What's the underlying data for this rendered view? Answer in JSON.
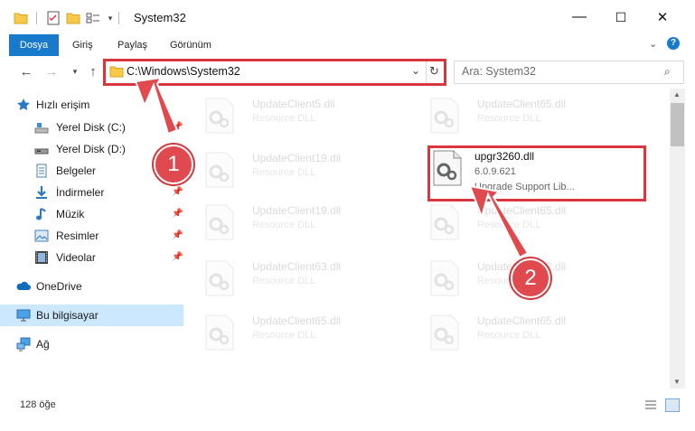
{
  "window": {
    "title": "System32",
    "buttons": {
      "minimize": "—",
      "maximize": "☐",
      "close": "✕"
    }
  },
  "ribbon": {
    "tabs": [
      {
        "label": "Dosya"
      },
      {
        "label": "Giriş"
      },
      {
        "label": "Paylaş"
      },
      {
        "label": "Görünüm"
      }
    ]
  },
  "address": {
    "path": "C:\\Windows\\System32"
  },
  "search": {
    "placeholder": "Ara: System32"
  },
  "sidebar": {
    "items": [
      {
        "label": "Hızlı erişim",
        "icon": "star-icon"
      },
      {
        "label": "Yerel Disk (C:)",
        "icon": "drive-icon"
      },
      {
        "label": "Yerel Disk (D:)",
        "icon": "drive-icon"
      },
      {
        "label": "Belgeler",
        "icon": "documents-icon"
      },
      {
        "label": "İndirmeler",
        "icon": "download-icon"
      },
      {
        "label": "Müzik",
        "icon": "music-icon"
      },
      {
        "label": "Resimler",
        "icon": "pictures-icon"
      },
      {
        "label": "Videolar",
        "icon": "videos-icon"
      },
      {
        "label": "OneDrive",
        "icon": "cloud-icon"
      },
      {
        "label": "Bu bilgisayar",
        "icon": "computer-icon"
      },
      {
        "label": "Ağ",
        "icon": "network-icon"
      }
    ]
  },
  "files": [
    {
      "name": "UpdateClient5.dll",
      "sub": "Resource DLL"
    },
    {
      "name": "UpdateClient65.dll",
      "sub": "Resource DLL"
    },
    {
      "name": "UpdateClient19.dll",
      "sub": "Resource DLL"
    },
    {
      "name": "upgr3260.dll",
      "version": "6.0.9.621",
      "desc": "Upgrade Support Lib..."
    },
    {
      "name": "UpdateClient19.dll",
      "sub": "Resource DLL"
    },
    {
      "name": "UpdateClient65.dll",
      "sub": "Resource DLL"
    },
    {
      "name": "UpdateClient63.dll",
      "sub": "Resource DLL"
    },
    {
      "name": "UpdateClient42.dll",
      "sub": "Resource DLL"
    },
    {
      "name": "UpdateClient65.dll",
      "sub": "Resource DLL"
    },
    {
      "name": "UpdateClient65.dll",
      "sub": "Resource DLL"
    }
  ],
  "status": {
    "count": "128 öğe"
  },
  "annotations": {
    "step1": "1",
    "step2": "2"
  },
  "colors": {
    "accent": "#1979ca",
    "highlight": "#d9363e",
    "selected": "#cce8ff"
  }
}
